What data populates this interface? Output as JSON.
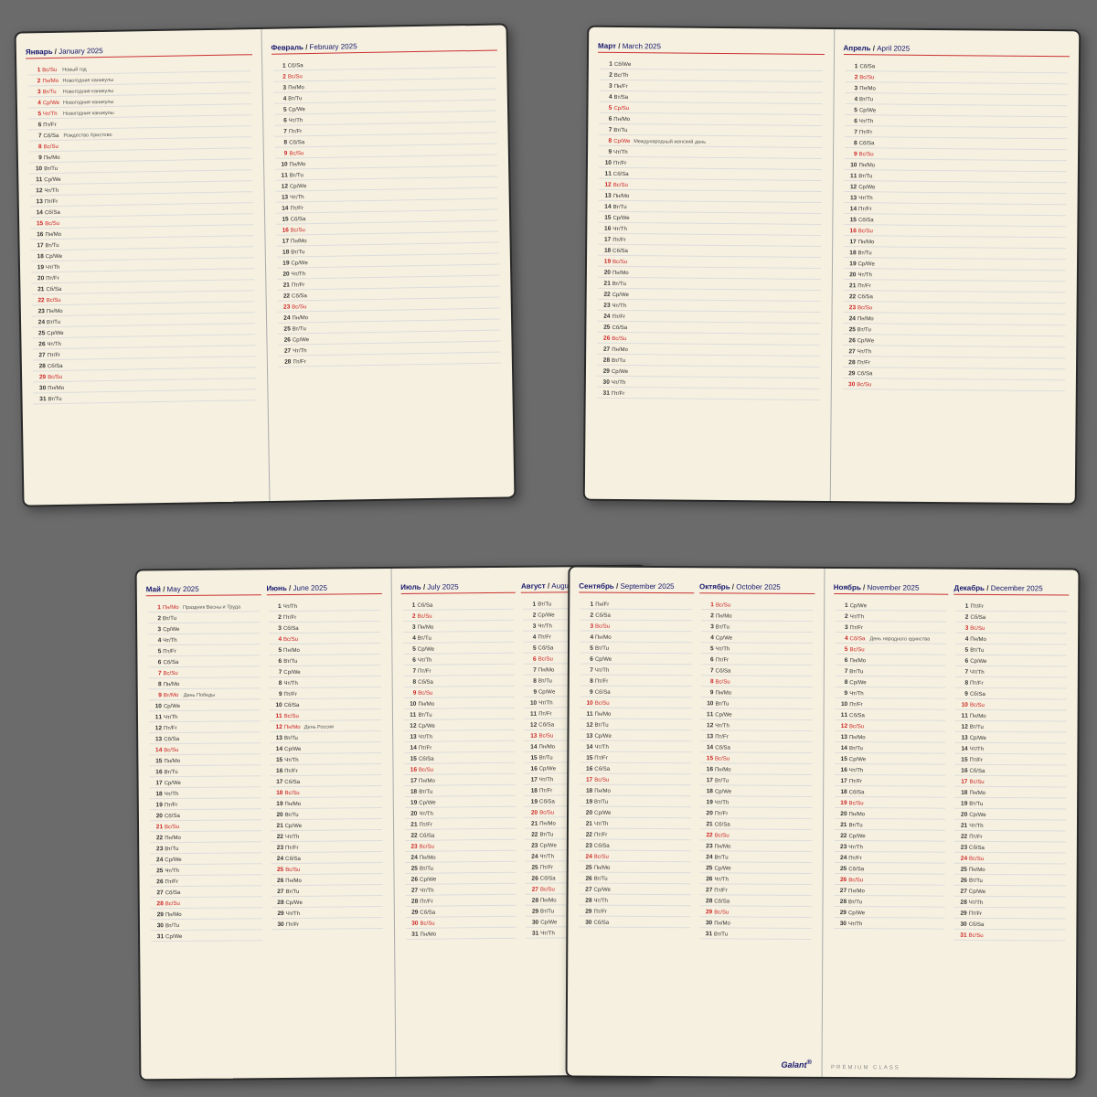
{
  "diaries": {
    "top_left": {
      "left_page": {
        "month_ru": "Январь",
        "month_en": "January 2025",
        "days": [
          {
            "num": "1",
            "day": "Вс/Su",
            "note": "Новый год",
            "type": "sunday"
          },
          {
            "num": "2",
            "day": "Пн/Mo",
            "note": "Новогодние каникулы",
            "type": "normal"
          },
          {
            "num": "3",
            "day": "Вт/Tu",
            "note": "Новогодние каникулы",
            "type": "normal"
          },
          {
            "num": "4",
            "day": "Ср/We",
            "note": "Новогодние каникулы",
            "type": "normal"
          },
          {
            "num": "5",
            "day": "Чт/Th",
            "note": "Новогодние каникулы",
            "type": "normal"
          },
          {
            "num": "6",
            "day": "Пт/Fr",
            "note": "",
            "type": "normal"
          },
          {
            "num": "7",
            "day": "Сб/Sa",
            "note": "Рождество Христово",
            "type": "normal"
          },
          {
            "num": "8",
            "day": "Вс/Su",
            "note": "",
            "type": "sunday"
          },
          {
            "num": "9",
            "day": "Пн/Mo",
            "note": "",
            "type": "normal"
          },
          {
            "num": "10",
            "day": "Вт/Tu",
            "note": "",
            "type": "normal"
          },
          {
            "num": "11",
            "day": "Ср/We",
            "note": "",
            "type": "normal"
          },
          {
            "num": "12",
            "day": "Чт/Th",
            "note": "",
            "type": "normal"
          },
          {
            "num": "13",
            "day": "Пт/Fr",
            "note": "",
            "type": "normal"
          },
          {
            "num": "14",
            "day": "Сб/Sa",
            "note": "",
            "type": "normal"
          },
          {
            "num": "15",
            "day": "Вс/Su",
            "note": "",
            "type": "sunday"
          },
          {
            "num": "16",
            "day": "Пн/Mo",
            "note": "",
            "type": "normal"
          },
          {
            "num": "17",
            "day": "Вт/Tu",
            "note": "",
            "type": "normal"
          },
          {
            "num": "18",
            "day": "Ср/We",
            "note": "",
            "type": "normal"
          },
          {
            "num": "19",
            "day": "Чт/Th",
            "note": "",
            "type": "normal"
          },
          {
            "num": "20",
            "day": "Пт/Fr",
            "note": "",
            "type": "normal"
          },
          {
            "num": "21",
            "day": "Сб/Sa",
            "note": "",
            "type": "normal"
          },
          {
            "num": "22",
            "day": "Вс/Su",
            "note": "",
            "type": "sunday"
          },
          {
            "num": "23",
            "day": "Пн/Mo",
            "note": "",
            "type": "normal"
          },
          {
            "num": "24",
            "day": "Вт/Tu",
            "note": "",
            "type": "normal"
          },
          {
            "num": "25",
            "day": "Ср/We",
            "note": "",
            "type": "normal"
          },
          {
            "num": "26",
            "day": "Чт/Th",
            "note": "",
            "type": "normal"
          },
          {
            "num": "27",
            "day": "Пт/Fr",
            "note": "",
            "type": "normal"
          },
          {
            "num": "28",
            "day": "Сб/Sa",
            "note": "",
            "type": "normal"
          },
          {
            "num": "29",
            "day": "Вс/Su",
            "note": "",
            "type": "sunday"
          },
          {
            "num": "30",
            "day": "Пн/Mo",
            "note": "",
            "type": "normal"
          },
          {
            "num": "31",
            "day": "Вт/Tu",
            "note": "",
            "type": "normal"
          }
        ]
      },
      "right_page": {
        "months": [
          {
            "month_ru": "Февраль",
            "month_en": "February 2025",
            "days": [
              {
                "num": "1",
                "day": "Сб/Sa",
                "note": "",
                "type": "normal"
              },
              {
                "num": "2",
                "day": "Вс/Su",
                "note": "",
                "type": "sunday"
              },
              {
                "num": "3",
                "day": "Пн/Mo",
                "note": "",
                "type": "normal"
              },
              {
                "num": "4",
                "day": "Вт/Tu",
                "note": "",
                "type": "normal"
              },
              {
                "num": "5",
                "day": "Ср/We",
                "note": "",
                "type": "normal"
              },
              {
                "num": "6",
                "day": "Чт/Th",
                "note": "",
                "type": "normal"
              },
              {
                "num": "7",
                "day": "Пт/Fr",
                "note": "",
                "type": "normal"
              },
              {
                "num": "8",
                "day": "Сб/Sa",
                "note": "",
                "type": "normal"
              },
              {
                "num": "9",
                "day": "Вс/Su",
                "note": "",
                "type": "sunday"
              },
              {
                "num": "10",
                "day": "Пн/Mo",
                "note": "",
                "type": "normal"
              },
              {
                "num": "11",
                "day": "Вт/Tu",
                "note": "",
                "type": "normal"
              },
              {
                "num": "12",
                "day": "Ср/We",
                "note": "",
                "type": "normal"
              },
              {
                "num": "13",
                "day": "Чт/Th",
                "note": "",
                "type": "normal"
              },
              {
                "num": "14",
                "day": "Пт/Fr",
                "note": "",
                "type": "normal"
              },
              {
                "num": "15",
                "day": "Сб/Sa",
                "note": "",
                "type": "normal"
              },
              {
                "num": "16",
                "day": "Вс/Su",
                "note": "",
                "type": "sunday"
              },
              {
                "num": "17",
                "day": "Пн/Mo",
                "note": "",
                "type": "normal"
              },
              {
                "num": "18",
                "day": "Вт/Tu",
                "note": "",
                "type": "normal"
              },
              {
                "num": "19",
                "day": "Ср/We",
                "note": "",
                "type": "normal"
              },
              {
                "num": "20",
                "day": "Чт/Th",
                "note": "",
                "type": "normal"
              },
              {
                "num": "21",
                "day": "Пт/Fr",
                "note": "",
                "type": "normal"
              },
              {
                "num": "22",
                "day": "Сб/Sa",
                "note": "",
                "type": "normal"
              },
              {
                "num": "23",
                "day": "Вс/Su",
                "note": "",
                "type": "sunday"
              },
              {
                "num": "24",
                "day": "Пн/Mo",
                "note": "",
                "type": "normal"
              },
              {
                "num": "25",
                "day": "Вт/Tu",
                "note": "",
                "type": "normal"
              },
              {
                "num": "26",
                "day": "Ср/We",
                "note": "",
                "type": "normal"
              },
              {
                "num": "27",
                "day": "Чт/Th",
                "note": "",
                "type": "normal"
              },
              {
                "num": "28",
                "day": "Пт/Fr",
                "note": "",
                "type": "normal"
              }
            ]
          }
        ]
      }
    }
  }
}
